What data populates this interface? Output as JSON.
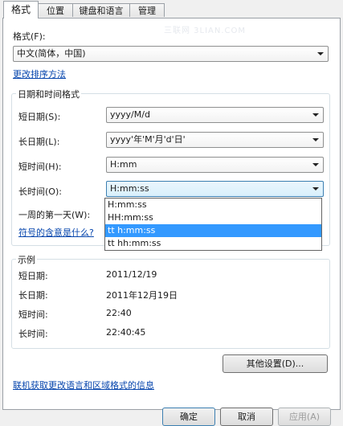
{
  "tabs": [
    {
      "label": "格式",
      "active": true
    },
    {
      "label": "位置",
      "active": false
    },
    {
      "label": "键盘和语言",
      "active": false
    },
    {
      "label": "管理",
      "active": false
    }
  ],
  "watermark": "三联网 3LIAN.COM",
  "format": {
    "label": "格式(F):",
    "value": "中文(简体，中国)"
  },
  "sort_link": "更改排序方法",
  "datetime_group": {
    "title": "日期和时间格式",
    "short_date_label": "短日期(S):",
    "short_date_value": "yyyy/M/d",
    "long_date_label": "长日期(L):",
    "long_date_value": "yyyy'年'M'月'd'日'",
    "short_time_label": "短时间(H):",
    "short_time_value": "H:mm",
    "long_time_label": "长时间(O):",
    "long_time_value": "H:mm:ss",
    "first_day_label": "一周的第一天(W):",
    "symbols_link": "符号的含意是什么?"
  },
  "long_time_options": [
    "H:mm:ss",
    "HH:mm:ss",
    "tt h:mm:ss",
    "tt hh:mm:ss"
  ],
  "long_time_selected_index": 2,
  "example_group": {
    "title": "示例",
    "short_date_label": "短日期:",
    "short_date_value": "2011/12/19",
    "long_date_label": "长日期:",
    "long_date_value": "2011年12月19日",
    "short_time_label": "短时间:",
    "short_time_value": "22:40",
    "long_time_label": "长时间:",
    "long_time_value": "22:40:45"
  },
  "other_settings_button": "其他设置(D)...",
  "online_link": "联机获取更改语言和区域格式的信息",
  "footer_buttons": {
    "ok": "确定",
    "cancel": "取消",
    "apply": "应用(A)"
  },
  "colors": {
    "accent": "#3399ff",
    "link": "#0645ad",
    "group_border": "#d5dfe5"
  }
}
